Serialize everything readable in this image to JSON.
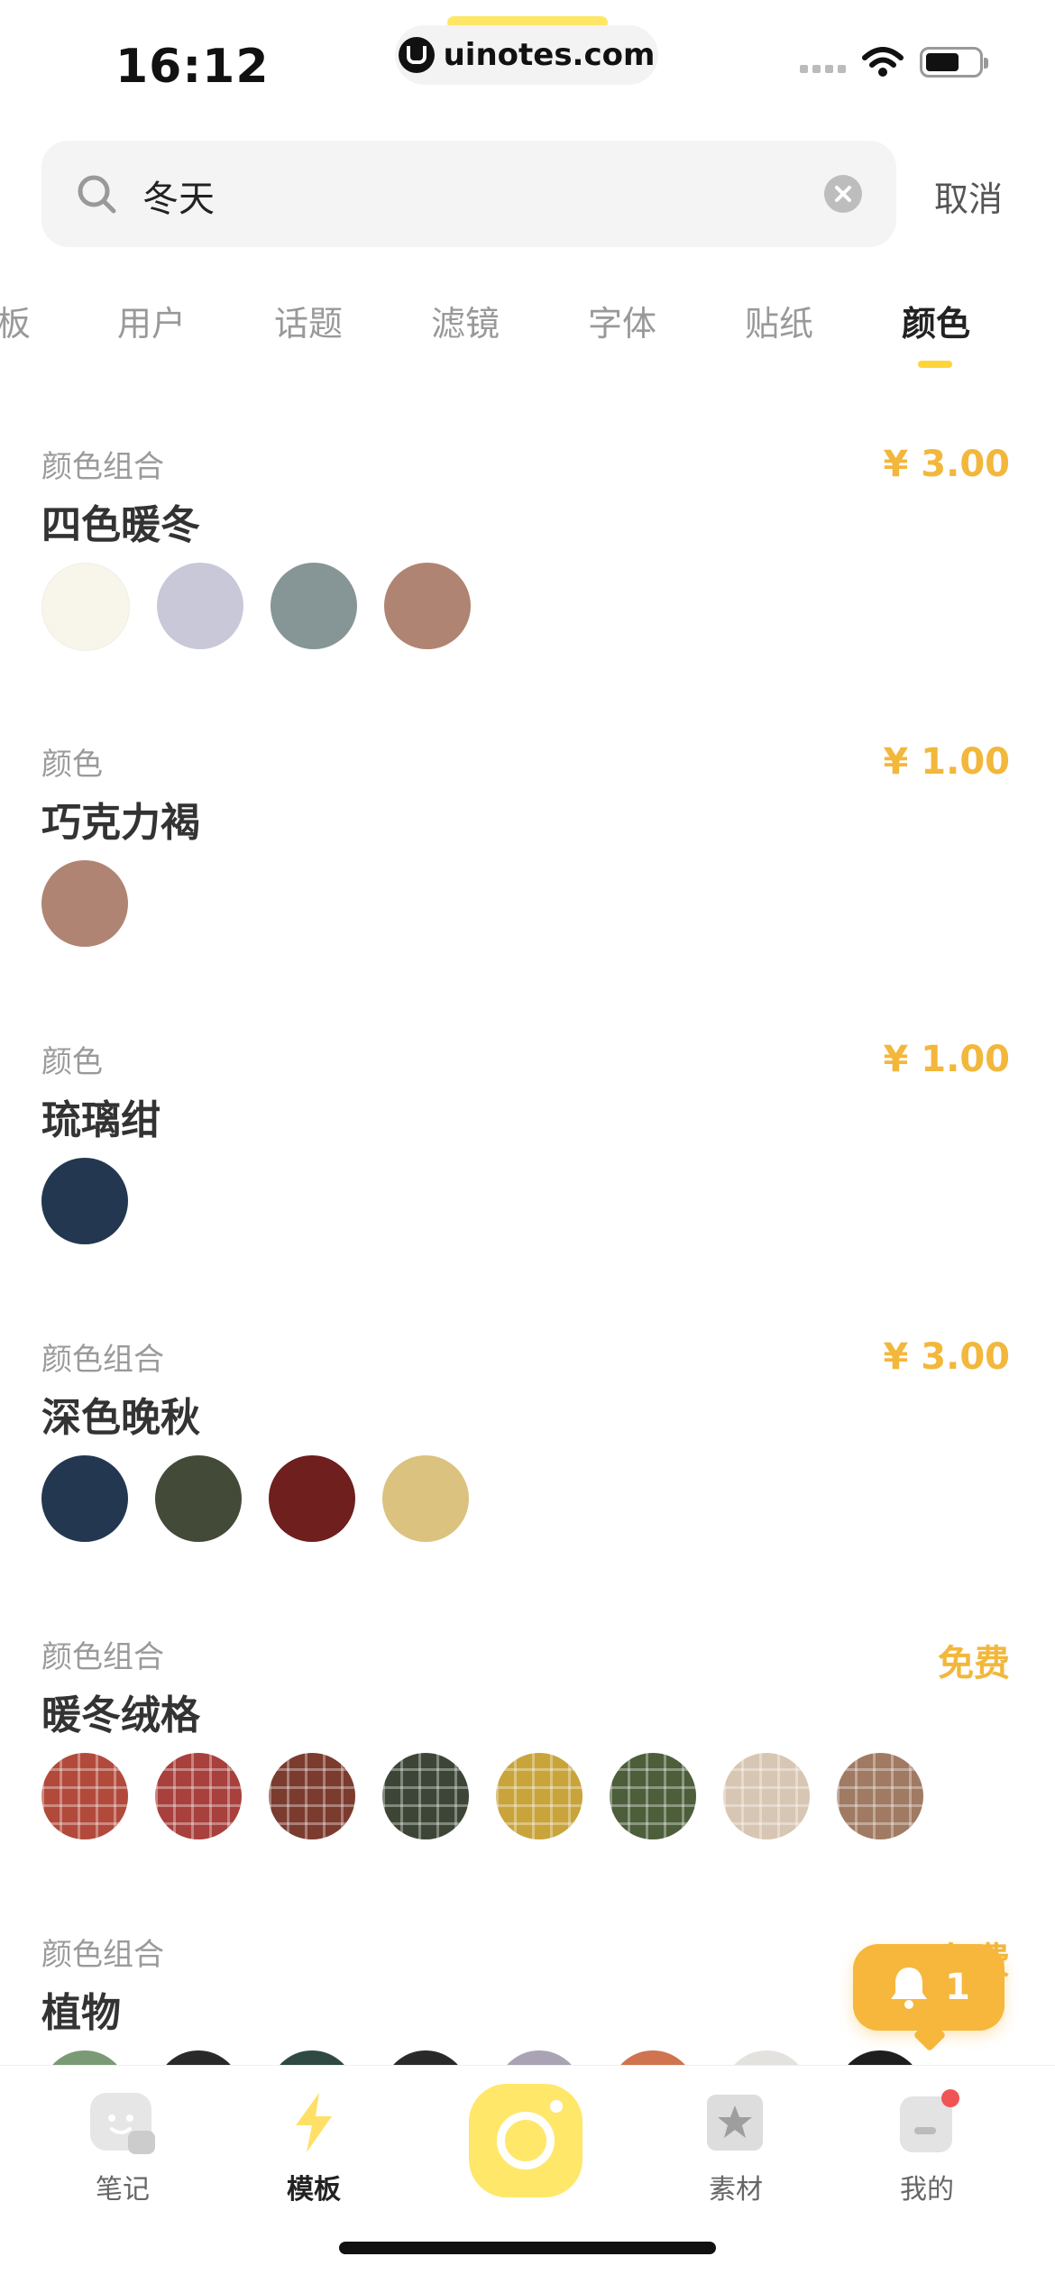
{
  "status_bar": {
    "time": "16:12",
    "url": "uinotes.com"
  },
  "search": {
    "value": "冬天",
    "cancel_label": "取消"
  },
  "tabs": [
    {
      "label": "板",
      "active": false
    },
    {
      "label": "用户",
      "active": false
    },
    {
      "label": "话题",
      "active": false
    },
    {
      "label": "滤镜",
      "active": false
    },
    {
      "label": "字体",
      "active": false
    },
    {
      "label": "贴纸",
      "active": false
    },
    {
      "label": "颜色",
      "active": true
    }
  ],
  "results": [
    {
      "type": "颜色组合",
      "title": "四色暖冬",
      "price": "¥ 3.00",
      "swatches": [
        "#f8f6ea",
        "#c9c8d8",
        "#869595",
        "#b08472"
      ]
    },
    {
      "type": "颜色",
      "title": "巧克力褐",
      "price": "¥ 1.00",
      "swatches": [
        "#b08472"
      ]
    },
    {
      "type": "颜色",
      "title": "琉璃绀",
      "price": "¥ 1.00",
      "swatches": [
        "#233750"
      ]
    },
    {
      "type": "颜色组合",
      "title": "深色晚秋",
      "price": "¥ 3.00",
      "swatches": [
        "#233750",
        "#434b38",
        "#6e1f1e",
        "#dcc27f"
      ]
    },
    {
      "type": "颜色组合",
      "title": "暖冬绒格",
      "price": "免费",
      "swatches": [
        "#b24a3c",
        "#a8403d",
        "#7b3b2e",
        "#3d4636",
        "#c9a43a",
        "#4c5e3a",
        "#d8c6b4",
        "#a07a62"
      ]
    },
    {
      "type": "颜色组合",
      "title": "植物",
      "price": "免费",
      "swatches": [
        "#7a9a76",
        "#2a2a2a",
        "#2f4a43",
        "#2a2a2a",
        "#a9a3b4",
        "#d0734f",
        "#e4e2df",
        "#1e1e1e"
      ]
    }
  ],
  "notification": {
    "count": "1"
  },
  "bottom_nav": {
    "notes": "笔记",
    "templates": "模板",
    "materials": "素材",
    "mine": "我的"
  },
  "colors": {
    "price": "#f2b73b",
    "accent_yellow": "#ffd43b",
    "camera_button": "#ffe76a",
    "badge_red": "#f05454"
  }
}
